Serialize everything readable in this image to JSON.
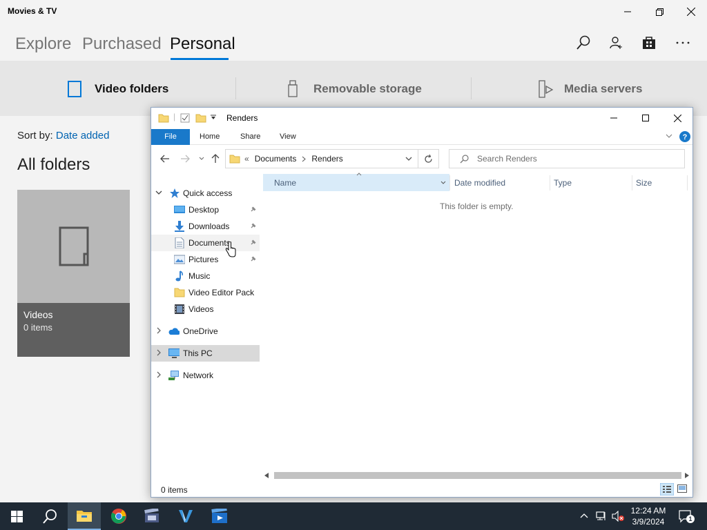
{
  "app": {
    "title": "Movies & TV",
    "tabs": [
      "Explore",
      "Purchased",
      "Personal"
    ],
    "active_tab": "Personal",
    "storage_tabs": [
      "Video folders",
      "Removable storage",
      "Media servers"
    ],
    "sort_label": "Sort by:",
    "sort_value": "Date added",
    "section_title": "All folders",
    "folders": [
      {
        "name": "Videos",
        "count": "0 items"
      }
    ],
    "accent": "#0078d7"
  },
  "explorer": {
    "title": "Renders",
    "ribbon_tabs": [
      "File",
      "Home",
      "Share",
      "View"
    ],
    "address": {
      "prefix": "«",
      "crumbs": [
        "Documents",
        "Renders"
      ]
    },
    "search_placeholder": "Search Renders",
    "nav": {
      "quick_access": "Quick access",
      "quick_items": [
        "Desktop",
        "Downloads",
        "Documents",
        "Pictures",
        "Music",
        "Video Editor Pack",
        "Videos"
      ],
      "onedrive": "OneDrive",
      "thispc": "This PC",
      "network": "Network"
    },
    "columns": [
      "Name",
      "Date modified",
      "Type",
      "Size"
    ],
    "empty_message": "This folder is empty.",
    "status": "0 items"
  },
  "taskbar": {
    "time": "12:24 AM",
    "date": "3/9/2024",
    "notification_count": "1"
  }
}
